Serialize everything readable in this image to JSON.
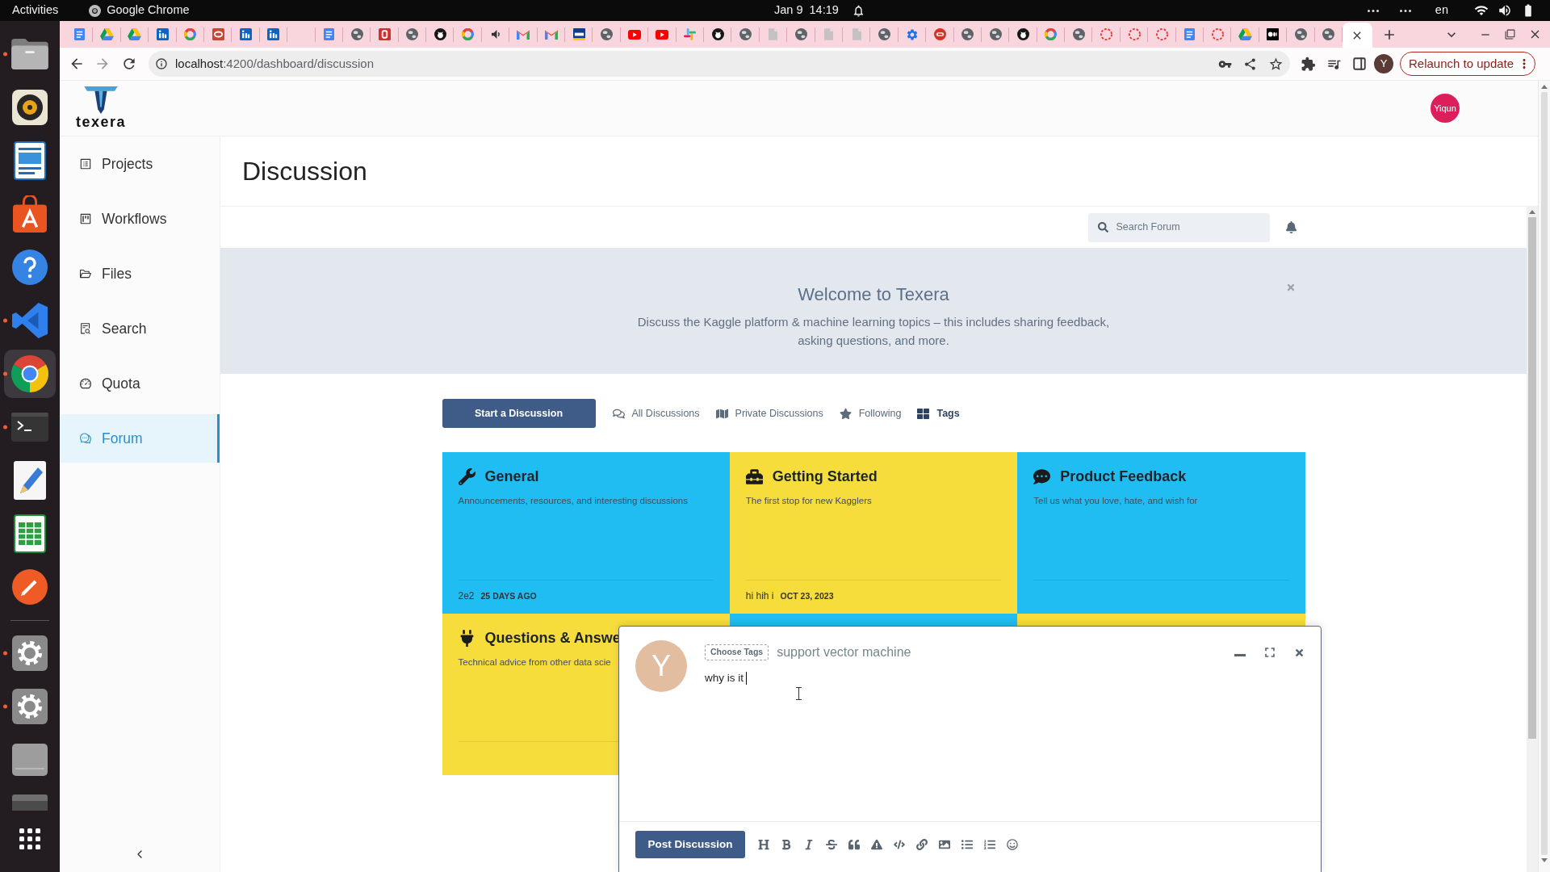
{
  "system_bar": {
    "activities": "Activities",
    "app": "Google Chrome",
    "date": "Jan 9",
    "time": "14:19",
    "language": "en"
  },
  "dock": [
    {
      "kind": "folder",
      "running": true,
      "selected": false
    },
    {
      "kind": "music",
      "running": false,
      "selected": false
    },
    {
      "kind": "writer",
      "running": false,
      "selected": false
    },
    {
      "kind": "store",
      "running": false,
      "selected": false
    },
    {
      "kind": "help",
      "running": false,
      "selected": false
    },
    {
      "kind": "code",
      "running": true,
      "selected": false
    },
    {
      "kind": "browser",
      "running": true,
      "selected": true
    },
    {
      "kind": "terminal",
      "running": true,
      "selected": false
    },
    {
      "kind": "editor",
      "running": false,
      "selected": false
    },
    {
      "kind": "sheet",
      "running": false,
      "selected": false
    },
    {
      "kind": "pen",
      "running": false,
      "selected": false
    },
    {
      "kind": "separator"
    },
    {
      "kind": "settings",
      "running": true,
      "selected": false
    },
    {
      "kind": "settings",
      "running": true,
      "selected": false
    },
    {
      "kind": "disk",
      "running": false,
      "selected": false
    },
    {
      "kind": "drive",
      "running": false,
      "selected": false
    },
    {
      "kind": "apps",
      "running": false,
      "selected": false
    }
  ],
  "browser": {
    "tabs": [
      {
        "kind": "doc",
        "selected": false
      },
      {
        "kind": "drive",
        "selected": false
      },
      {
        "kind": "drive",
        "selected": false
      },
      {
        "kind": "in-tile",
        "selected": false
      },
      {
        "kind": "g",
        "selected": false
      },
      {
        "kind": "red-ring",
        "selected": false
      },
      {
        "kind": "in-tile",
        "selected": false
      },
      {
        "kind": "in-tile",
        "selected": false
      },
      {
        "kind": "blank",
        "selected": false
      },
      {
        "kind": "doc",
        "selected": false
      },
      {
        "kind": "globe",
        "selected": false
      },
      {
        "kind": "b-tile",
        "selected": false
      },
      {
        "kind": "globe",
        "selected": false
      },
      {
        "kind": "cat",
        "selected": false
      },
      {
        "kind": "g",
        "selected": false
      },
      {
        "kind": "speaker",
        "selected": false
      },
      {
        "kind": "envelope",
        "selected": false
      },
      {
        "kind": "envelope",
        "selected": false
      },
      {
        "kind": "uci-tile",
        "selected": false
      },
      {
        "kind": "globe",
        "selected": false
      },
      {
        "kind": "play",
        "selected": false
      },
      {
        "kind": "play",
        "selected": false
      },
      {
        "kind": "hash",
        "selected": false
      },
      {
        "kind": "cat",
        "selected": false
      },
      {
        "kind": "globe",
        "selected": false
      },
      {
        "kind": "page",
        "selected": false
      },
      {
        "kind": "globe",
        "selected": false
      },
      {
        "kind": "page",
        "selected": false
      },
      {
        "kind": "page",
        "selected": false
      },
      {
        "kind": "globe",
        "selected": false
      },
      {
        "kind": "gear",
        "selected": false
      },
      {
        "kind": "badge",
        "selected": false
      },
      {
        "kind": "globe",
        "selected": false
      },
      {
        "kind": "globe",
        "selected": false
      },
      {
        "kind": "cat",
        "selected": false
      },
      {
        "kind": "g",
        "selected": false
      },
      {
        "kind": "globe",
        "selected": false
      },
      {
        "kind": "dashed",
        "selected": false
      },
      {
        "kind": "dashed",
        "selected": false
      },
      {
        "kind": "dashed",
        "selected": false
      },
      {
        "kind": "doc",
        "selected": false
      },
      {
        "kind": "dashed",
        "selected": false
      },
      {
        "kind": "drive",
        "selected": false
      },
      {
        "kind": "dots",
        "selected": false
      },
      {
        "kind": "globe",
        "selected": false
      },
      {
        "kind": "globe",
        "selected": false
      },
      {
        "kind": "blank",
        "selected": true
      }
    ],
    "url_host": "localhost",
    "url_path": ":4200/dashboard/discussion",
    "profile": "Y",
    "update_button": "Relaunch to update"
  },
  "app": {
    "logo": "texera",
    "avatar": "Yiqun",
    "sidebar": [
      {
        "label": "Projects",
        "selected": false
      },
      {
        "label": "Workflows",
        "selected": false
      },
      {
        "label": "Files",
        "selected": false
      },
      {
        "label": "Search",
        "selected": false
      },
      {
        "label": "Quota",
        "selected": false
      },
      {
        "label": "Forum",
        "selected": true
      }
    ],
    "page_title": "Discussion"
  },
  "forum": {
    "search": {
      "placeholder": "Search Forum"
    },
    "banner": {
      "title": "Welcome to Texera",
      "text": "Discuss the Kaggle platform & machine learning topics – this includes sharing feedback, asking questions, and more."
    },
    "start_button": "Start a Discussion",
    "filters": [
      {
        "label": "All Discussions",
        "selected": false
      },
      {
        "label": "Private Discussions",
        "selected": false
      },
      {
        "label": "Following",
        "selected": false
      },
      {
        "label": "Tags",
        "selected": true
      }
    ],
    "categories": [
      {
        "title": "General",
        "description": "Announcements, resources, and interesting discussions",
        "latest_post": "2e2",
        "latest_date": "25 DAYS AGO",
        "color": "#1fbdf2"
      },
      {
        "title": "Getting Started",
        "description": "The first stop for new Kagglers",
        "latest_post": "hi hih i",
        "latest_date": "OCT 23, 2023",
        "color": "#f7dd3c"
      },
      {
        "title": "Product Feedback",
        "description": "Tell us what you love, hate, and wish for",
        "color": "#1fbdf2"
      },
      {
        "title": "Questions & Answe",
        "description": "Technical advice from other data scie",
        "color": "#f7dd3c"
      },
      {
        "color": "#1fbdf2"
      },
      {
        "color": "#f7dd3c"
      }
    ]
  },
  "composer": {
    "avatar": "Y",
    "tags_button": "Choose Tags",
    "title": "support vector machine",
    "body": "why is it",
    "post_button": "Post Discussion"
  }
}
